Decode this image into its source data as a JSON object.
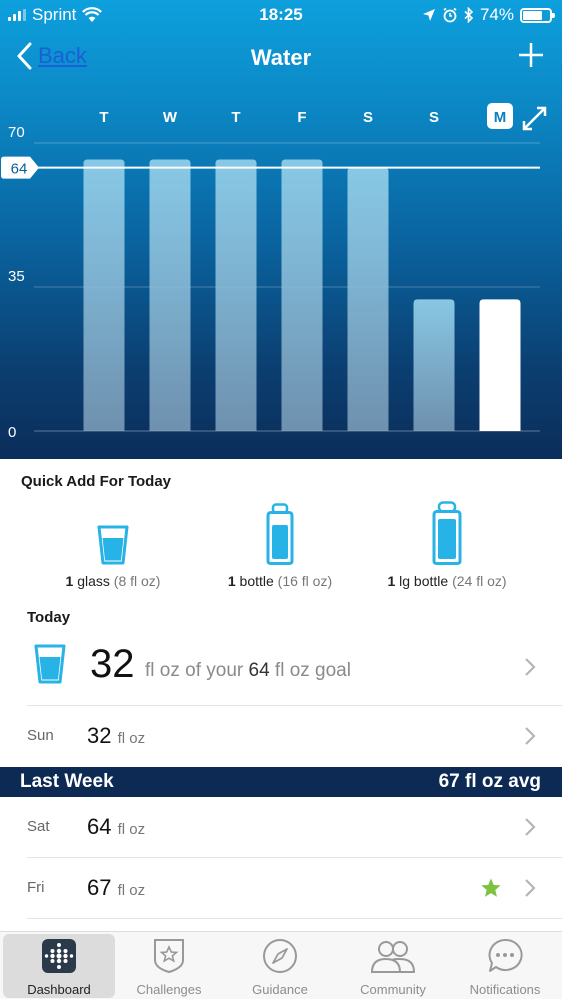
{
  "status_bar": {
    "carrier": "Sprint",
    "time": "18:25",
    "battery_pct": "74%",
    "battery_level": 0.74
  },
  "nav": {
    "back_label": "Back",
    "title": "Water"
  },
  "chart_data": {
    "type": "bar",
    "categories": [
      "T",
      "W",
      "T",
      "F",
      "S",
      "S",
      "M"
    ],
    "values": [
      66,
      66,
      66,
      66,
      64,
      32,
      32
    ],
    "highlight_index": 6,
    "yticks": [
      "70",
      "35",
      "0"
    ],
    "ylim": [
      0,
      70
    ],
    "goal_line": 64,
    "goal_label": "64",
    "xlabel": "",
    "ylabel": "",
    "grid": true
  },
  "quick_add": {
    "title": "Quick Add For Today",
    "items": [
      {
        "qty": "1",
        "name": "glass",
        "size": "(8 fl oz)",
        "icon": "glass-icon"
      },
      {
        "qty": "1",
        "name": "bottle",
        "size": "(16 fl oz)",
        "icon": "bottle-icon"
      },
      {
        "qty": "1",
        "name": "lg bottle",
        "size": "(24 fl oz)",
        "icon": "large-bottle-icon"
      }
    ]
  },
  "today": {
    "title": "Today",
    "amount": "32",
    "pre_goal": "fl oz of your",
    "goal": "64",
    "post_goal": "fl oz goal"
  },
  "recent": {
    "day": "Sun",
    "value": "32",
    "unit": "fl oz"
  },
  "last_week": {
    "title": "Last Week",
    "avg": "67 fl oz avg",
    "days": [
      {
        "day": "Sat",
        "value": "64",
        "unit": "fl oz",
        "star": false
      },
      {
        "day": "Fri",
        "value": "67",
        "unit": "fl oz",
        "star": true
      }
    ]
  },
  "tabs": [
    {
      "label": "Dashboard",
      "icon": "dashboard-icon",
      "active": true
    },
    {
      "label": "Challenges",
      "icon": "challenges-icon",
      "active": false
    },
    {
      "label": "Guidance",
      "icon": "compass-icon",
      "active": false
    },
    {
      "label": "Community",
      "icon": "community-icon",
      "active": false
    },
    {
      "label": "Notifications",
      "icon": "notifications-icon",
      "active": false
    }
  ],
  "colors": {
    "accent": "#28b3e6",
    "header_top": "#0da0dd",
    "header_bottom": "#0b2d5a",
    "star": "#7dc242"
  }
}
